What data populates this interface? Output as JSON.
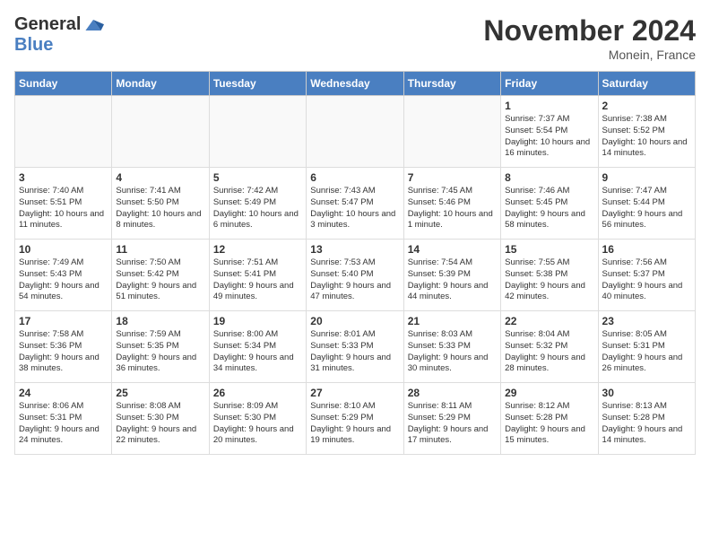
{
  "logo": {
    "general": "General",
    "blue": "Blue"
  },
  "title": "November 2024",
  "location": "Monein, France",
  "days_of_week": [
    "Sunday",
    "Monday",
    "Tuesday",
    "Wednesday",
    "Thursday",
    "Friday",
    "Saturday"
  ],
  "weeks": [
    [
      {
        "day": "",
        "info": ""
      },
      {
        "day": "",
        "info": ""
      },
      {
        "day": "",
        "info": ""
      },
      {
        "day": "",
        "info": ""
      },
      {
        "day": "",
        "info": ""
      },
      {
        "day": "1",
        "info": "Sunrise: 7:37 AM\nSunset: 5:54 PM\nDaylight: 10 hours and 16 minutes."
      },
      {
        "day": "2",
        "info": "Sunrise: 7:38 AM\nSunset: 5:52 PM\nDaylight: 10 hours and 14 minutes."
      }
    ],
    [
      {
        "day": "3",
        "info": "Sunrise: 7:40 AM\nSunset: 5:51 PM\nDaylight: 10 hours and 11 minutes."
      },
      {
        "day": "4",
        "info": "Sunrise: 7:41 AM\nSunset: 5:50 PM\nDaylight: 10 hours and 8 minutes."
      },
      {
        "day": "5",
        "info": "Sunrise: 7:42 AM\nSunset: 5:49 PM\nDaylight: 10 hours and 6 minutes."
      },
      {
        "day": "6",
        "info": "Sunrise: 7:43 AM\nSunset: 5:47 PM\nDaylight: 10 hours and 3 minutes."
      },
      {
        "day": "7",
        "info": "Sunrise: 7:45 AM\nSunset: 5:46 PM\nDaylight: 10 hours and 1 minute."
      },
      {
        "day": "8",
        "info": "Sunrise: 7:46 AM\nSunset: 5:45 PM\nDaylight: 9 hours and 58 minutes."
      },
      {
        "day": "9",
        "info": "Sunrise: 7:47 AM\nSunset: 5:44 PM\nDaylight: 9 hours and 56 minutes."
      }
    ],
    [
      {
        "day": "10",
        "info": "Sunrise: 7:49 AM\nSunset: 5:43 PM\nDaylight: 9 hours and 54 minutes."
      },
      {
        "day": "11",
        "info": "Sunrise: 7:50 AM\nSunset: 5:42 PM\nDaylight: 9 hours and 51 minutes."
      },
      {
        "day": "12",
        "info": "Sunrise: 7:51 AM\nSunset: 5:41 PM\nDaylight: 9 hours and 49 minutes."
      },
      {
        "day": "13",
        "info": "Sunrise: 7:53 AM\nSunset: 5:40 PM\nDaylight: 9 hours and 47 minutes."
      },
      {
        "day": "14",
        "info": "Sunrise: 7:54 AM\nSunset: 5:39 PM\nDaylight: 9 hours and 44 minutes."
      },
      {
        "day": "15",
        "info": "Sunrise: 7:55 AM\nSunset: 5:38 PM\nDaylight: 9 hours and 42 minutes."
      },
      {
        "day": "16",
        "info": "Sunrise: 7:56 AM\nSunset: 5:37 PM\nDaylight: 9 hours and 40 minutes."
      }
    ],
    [
      {
        "day": "17",
        "info": "Sunrise: 7:58 AM\nSunset: 5:36 PM\nDaylight: 9 hours and 38 minutes."
      },
      {
        "day": "18",
        "info": "Sunrise: 7:59 AM\nSunset: 5:35 PM\nDaylight: 9 hours and 36 minutes."
      },
      {
        "day": "19",
        "info": "Sunrise: 8:00 AM\nSunset: 5:34 PM\nDaylight: 9 hours and 34 minutes."
      },
      {
        "day": "20",
        "info": "Sunrise: 8:01 AM\nSunset: 5:33 PM\nDaylight: 9 hours and 31 minutes."
      },
      {
        "day": "21",
        "info": "Sunrise: 8:03 AM\nSunset: 5:33 PM\nDaylight: 9 hours and 30 minutes."
      },
      {
        "day": "22",
        "info": "Sunrise: 8:04 AM\nSunset: 5:32 PM\nDaylight: 9 hours and 28 minutes."
      },
      {
        "day": "23",
        "info": "Sunrise: 8:05 AM\nSunset: 5:31 PM\nDaylight: 9 hours and 26 minutes."
      }
    ],
    [
      {
        "day": "24",
        "info": "Sunrise: 8:06 AM\nSunset: 5:31 PM\nDaylight: 9 hours and 24 minutes."
      },
      {
        "day": "25",
        "info": "Sunrise: 8:08 AM\nSunset: 5:30 PM\nDaylight: 9 hours and 22 minutes."
      },
      {
        "day": "26",
        "info": "Sunrise: 8:09 AM\nSunset: 5:30 PM\nDaylight: 9 hours and 20 minutes."
      },
      {
        "day": "27",
        "info": "Sunrise: 8:10 AM\nSunset: 5:29 PM\nDaylight: 9 hours and 19 minutes."
      },
      {
        "day": "28",
        "info": "Sunrise: 8:11 AM\nSunset: 5:29 PM\nDaylight: 9 hours and 17 minutes."
      },
      {
        "day": "29",
        "info": "Sunrise: 8:12 AM\nSunset: 5:28 PM\nDaylight: 9 hours and 15 minutes."
      },
      {
        "day": "30",
        "info": "Sunrise: 8:13 AM\nSunset: 5:28 PM\nDaylight: 9 hours and 14 minutes."
      }
    ]
  ]
}
